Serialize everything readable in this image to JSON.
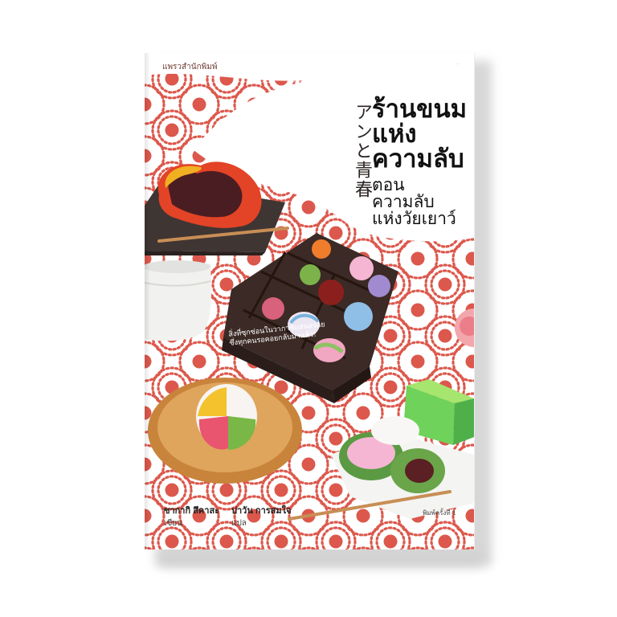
{
  "cover": {
    "publisher": "แพรวสำนักพิมพ์",
    "japanese_title": "アンと青春",
    "title_lines": [
      "ร้านขนม",
      "แห่ง",
      "ความลับ"
    ],
    "subtitle_lines": [
      "ตอน",
      "ความลับ",
      "แห่งวัยเยาว์"
    ],
    "tagline_lines": [
      "สิ่งที่ซุกซ่อนในวากาชิแสนอร่อย",
      "ซึ่งทุกคนรอคอยกลับมาแล้ว!"
    ],
    "author": {
      "name": "ซากากิ สึคาสะ",
      "role": "เขียน"
    },
    "translator": {
      "name": "ปาวัน การสมใจ",
      "role": "แปล"
    },
    "edition": "พิมพ์ครั้งที่ 1"
  },
  "colors": {
    "pattern_red": "#d94a3c",
    "box_brown": "#3b2a26",
    "title_black": "#111111"
  }
}
